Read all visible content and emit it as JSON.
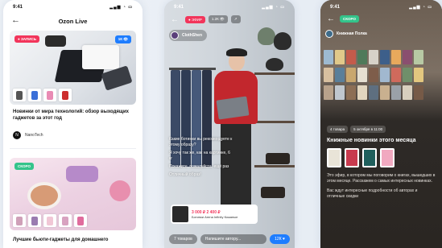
{
  "phone1": {
    "status": {
      "time": "9:41",
      "signal": "▂▄▆ ◔ ▭"
    },
    "header": {
      "back_icon": "arrow-left-icon",
      "title": "Ozon Live"
    },
    "card1": {
      "badge": "● ЗАПИСЬ",
      "views": "1К 👁",
      "title": "Новинки от мира технологий: обзор выходящих гаджетов за этот год",
      "author": "NanoTech",
      "author_initial": "N"
    },
    "card2": {
      "badge": "СКОРО",
      "title": "Лучшие бьюти-гаджеты для домашнего"
    }
  },
  "phone2": {
    "status": {
      "time": "9:41",
      "signal": "▂▄▆ ◔ ▭"
    },
    "top": {
      "back_icon": "arrow-left-icon",
      "live_badge": "● ЭФИР",
      "viewers": "1.2К 👁",
      "share_icon": "share-icon"
    },
    "host": "ClothShen",
    "chat": [
      "Какие ботинки вы рекомендуете к этому образу?",
      "Я хочу так же, как на картинке, 6 кг",
      "Покажите, пожалуйста, ещё раз",
      "Отличный образ!"
    ],
    "product": {
      "price": "3 000 ₽ 2 400 ₽",
      "name": "Ботинки Arena Infinity Кожаные",
      "old_price": ""
    },
    "bottom": {
      "products_button": "7 товаров",
      "message_placeholder": "Напишите автору...",
      "likes_button": "12К ♥"
    }
  },
  "phone3": {
    "status": {
      "time": "9:41",
      "signal": "▂▄▆ ◔ ▭"
    },
    "top": {
      "back_icon": "arrow-left-icon",
      "badge": "СКОРО"
    },
    "host": "Книжная Полка",
    "panel": {
      "tag1": "4 товара",
      "tag2": "5 октября в 11:00",
      "title": "Книжные новинки этого месяца",
      "desc1": "Это эфир, в котором мы поговорим о книгах, вышедших в этом месяце. Расскажем о самых интересных новинках.",
      "desc2": "Вас ждут интересные подробности об авторах и отличные скидки"
    }
  },
  "colors": {
    "red_badge": "#f2355b",
    "green_badge": "#34c48b",
    "blue_accent": "#1e7dff"
  }
}
